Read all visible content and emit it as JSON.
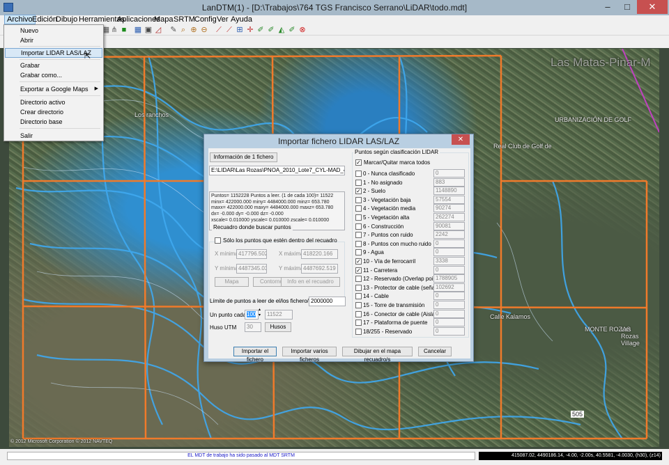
{
  "window": {
    "title": "LanDTM(1) - [D:\\Trabajos\\764 TGS Francisco Serrano\\LiDAR\\todo.mdt]",
    "min": "–",
    "max": "□",
    "close": "✕"
  },
  "menubar": {
    "items": [
      "Archivo",
      "Edición",
      "Dibujo",
      "Herramientas",
      "Aplicaciones",
      "Mapa",
      "SRTM",
      "Config",
      "Ver",
      "Ayuda"
    ]
  },
  "archivo_menu": {
    "nuevo": "Nuevo",
    "abrir": "Abrir",
    "importar_lidar": "Importar LIDAR LAS/LAZ",
    "grabar": "Grabar",
    "grabar_como": "Grabar como...",
    "exportar_google": "Exportar a Google Maps",
    "directorio_activo": "Directorio activo",
    "crear_directorio": "Crear directorio",
    "directorio_base": "Directorio base",
    "salir": "Salir"
  },
  "map": {
    "labels": {
      "town": "Las Matas-Pinar-M",
      "urbanizacion": "URBANIZACIÓN DE GOLF",
      "club_golf": "Real Club de Golf de",
      "los_ranchos": "Los ranchos",
      "monte_rozas": "MONTE ROZAS",
      "rozas_village": "Las Rozas Village",
      "calle_kalamos": "Calle Kalamos",
      "road_505": "505",
      "copyright": "© 2012 Microsoft Corporation © 2012 NAVTEQ"
    }
  },
  "dialog": {
    "title": "Importar fichero LIDAR LAS/LAZ",
    "close": "✕",
    "info_button": "Información de 1 fichero",
    "file_path": "E:\\LIDAR\\Las Rozas\\PNOA_2010_Lote7_CYL-MAD_422-448",
    "info_lines": [
      "Puntos= 1152228 Puntos a leer. (1 de cada 100)= 11522",
      "minx= 422000.000 miny= 4484000.000 minz= 653.780",
      "maxx= 422000.000 maxy= 4484000.000 maxz= 653.780",
      "dx= -0.000 dy= -0.000 dz= -0.000",
      "xscale= 0.010000 yscale= 0.010000 zscale= 0.010000"
    ],
    "recuadro": {
      "title": "Recuadro donde buscar puntos",
      "solo_label": "Sólo los puntos que estén dentro del recuadro",
      "xmin_label": "X mínima",
      "xmin_value": "417796.502",
      "xmax_label": "X máxima",
      "xmax_value": "418220.166",
      "ymin_label": "Y mínima",
      "ymin_value": "4487345.035",
      "ymax_label": "Y máxima",
      "ymax_value": "4487692.519",
      "btn_mapa": "Mapa",
      "btn_contorno": "Contorno",
      "btn_info_recuadro": "Info en el recuadro"
    },
    "limite_label": "Límite de puntos a leer de el/los fichero/s",
    "limite_value": "2000000",
    "un_punto_label": "Un punto cada",
    "un_punto_value": "100",
    "un_punto_result": "11522",
    "huso_label": "Huso UTM",
    "huso_value": "30",
    "husos_button": "Husos",
    "clasificacion": {
      "title": "Puntos según clasificación LIDAR",
      "marcar_todos": "Marcar/Quitar marca todos",
      "rows": [
        {
          "label": "0 - Nunca clasificado",
          "value": "0",
          "checked": false
        },
        {
          "label": "1 - No asignado",
          "value": "883",
          "checked": false
        },
        {
          "label": "2 - Suelo",
          "value": "1148890",
          "checked": true
        },
        {
          "label": "3 - Vegetación baja",
          "value": "57554",
          "checked": false
        },
        {
          "label": "4 - Vegetación media",
          "value": "90274",
          "checked": false
        },
        {
          "label": "5 - Vegetación alta",
          "value": "262274",
          "checked": false
        },
        {
          "label": "6 - Construcción",
          "value": "90081",
          "checked": false
        },
        {
          "label": "7 - Puntos con ruido",
          "value": "2242",
          "checked": false
        },
        {
          "label": "8 - Puntos con mucho ruido",
          "value": "0",
          "checked": false
        },
        {
          "label": "9 - Agua",
          "value": "0",
          "checked": false
        },
        {
          "label": "10 - Vía de ferrocarril",
          "value": "3338",
          "checked": true
        },
        {
          "label": "11 - Carretera",
          "value": "0",
          "checked": true
        },
        {
          "label": "12 - Reservado (Overlap points)",
          "value": "1788905",
          "checked": false
        },
        {
          "label": "13 - Protector de cable (señal)",
          "value": "102692",
          "checked": false
        },
        {
          "label": "14 - Cable",
          "value": "0",
          "checked": false
        },
        {
          "label": "15 - Torre de transmisión",
          "value": "0",
          "checked": false
        },
        {
          "label": "16 - Conector de cable (Aislante)",
          "value": "0",
          "checked": false
        },
        {
          "label": "17 - Plataforma de puente",
          "value": "0",
          "checked": false
        },
        {
          "label": "18/255 - Reservado",
          "value": "0",
          "checked": false
        }
      ]
    },
    "btn_importar": "Importar el fichero",
    "btn_importar_varios": "Importar varios ficheros",
    "btn_dibujar": "Dibujar en el mapa recuadro/s",
    "btn_cancelar": "Cancelar"
  },
  "status": {
    "message": "EL MDT de trabajo ha sido pasado al MDT SRTM",
    "coords": "415087.02, 4490186.14, -4.00, -2.00s, 40.5581, -4.0030, (h30), (z14)"
  },
  "colors": {
    "contour": "#3fa9f0",
    "grid": "#f07a2a",
    "status_text": "#1818c8"
  }
}
